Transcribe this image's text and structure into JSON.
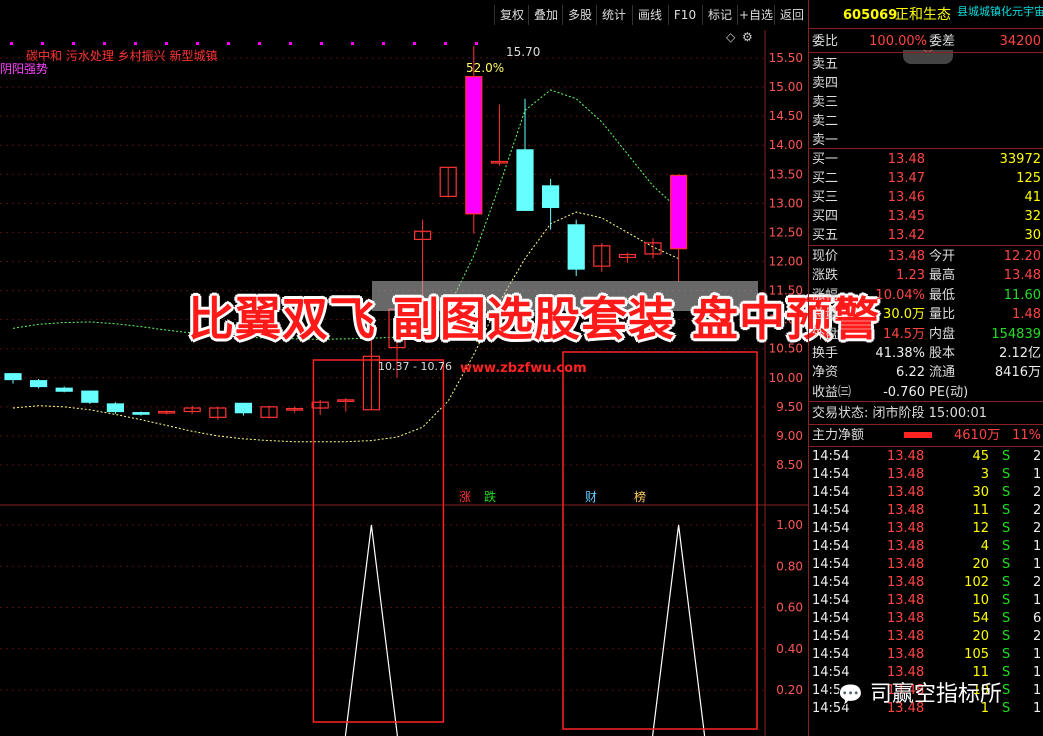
{
  "toolbar": {
    "buttons": [
      "复权",
      "叠加",
      "多股",
      "统计",
      "画线",
      "F10",
      "标记",
      "+自选",
      "返回"
    ]
  },
  "chart": {
    "concepts": "碳中和 污水处理 乡村振兴 新型城镇",
    "indicator_label": "阴阳强势",
    "high_label": "15.70",
    "pct_label": "52.0%",
    "range_label": "10.37 - 10.76",
    "website": "www.zbzfwu.com",
    "tags": [
      "涨",
      "跌",
      "财",
      "榜"
    ],
    "price_ticks": [
      "15.50",
      "15.00",
      "14.50",
      "14.00",
      "13.50",
      "13.00",
      "12.50",
      "12.00",
      "11.50",
      "11.00",
      "10.50",
      "10.00",
      "9.50",
      "9.00",
      "8.50"
    ],
    "sub_ticks": [
      "1.00",
      "0.80",
      "0.60",
      "0.40",
      "0.20"
    ],
    "colors": {
      "up": "#ff00ff",
      "up_border": "#ff3333",
      "down": "#66ffff",
      "ma": "#ffff88",
      "ma2": "#66ff66"
    },
    "candles": [
      {
        "o": 10.07,
        "h": 10.05,
        "l": 9.9,
        "c": 9.97
      },
      {
        "o": 9.95,
        "h": 9.98,
        "l": 9.82,
        "c": 9.85
      },
      {
        "o": 9.82,
        "h": 9.85,
        "l": 9.75,
        "c": 9.77
      },
      {
        "o": 9.77,
        "h": 9.78,
        "l": 9.55,
        "c": 9.58
      },
      {
        "o": 9.55,
        "h": 9.58,
        "l": 9.38,
        "c": 9.42
      },
      {
        "o": 9.4,
        "h": 9.42,
        "l": 9.35,
        "c": 9.38
      },
      {
        "o": 9.4,
        "h": 9.44,
        "l": 9.37,
        "c": 9.42
      },
      {
        "o": 9.42,
        "h": 9.52,
        "l": 9.38,
        "c": 9.48
      },
      {
        "o": 9.32,
        "h": 9.5,
        "l": 9.28,
        "c": 9.48
      },
      {
        "o": 9.56,
        "h": 9.56,
        "l": 9.35,
        "c": 9.4
      },
      {
        "o": 9.32,
        "h": 9.52,
        "l": 9.3,
        "c": 9.5
      },
      {
        "o": 9.45,
        "h": 9.5,
        "l": 9.4,
        "c": 9.47
      },
      {
        "o": 9.48,
        "h": 9.62,
        "l": 9.36,
        "c": 9.58
      },
      {
        "o": 9.6,
        "h": 9.65,
        "l": 9.42,
        "c": 9.62
      },
      {
        "o": 9.45,
        "h": 10.76,
        "l": 9.45,
        "c": 10.37
      },
      {
        "o": 10.52,
        "h": 11.26,
        "l": 10.0,
        "c": 11.18
      },
      {
        "o": 12.38,
        "h": 12.72,
        "l": 11.4,
        "c": 12.52
      },
      {
        "o": 13.12,
        "h": 13.62,
        "l": 13.1,
        "c": 13.62
      },
      {
        "o": 12.82,
        "h": 15.7,
        "l": 12.48,
        "c": 15.18
      },
      {
        "o": 13.72,
        "h": 14.7,
        "l": 13.65,
        "c": 13.72
      },
      {
        "o": 13.92,
        "h": 14.8,
        "l": 12.88,
        "c": 12.88
      },
      {
        "o": 13.3,
        "h": 13.42,
        "l": 12.55,
        "c": 12.93
      },
      {
        "o": 12.63,
        "h": 12.72,
        "l": 11.75,
        "c": 11.87
      },
      {
        "o": 11.92,
        "h": 12.32,
        "l": 11.82,
        "c": 12.27
      },
      {
        "o": 12.07,
        "h": 12.15,
        "l": 11.98,
        "c": 12.12
      },
      {
        "o": 12.13,
        "h": 12.4,
        "l": 12.05,
        "c": 12.32
      },
      {
        "o": 12.22,
        "h": 13.5,
        "l": 11.65,
        "c": 13.48
      }
    ],
    "ma_upper": [
      10.85,
      10.92,
      10.95,
      10.96,
      10.93,
      10.88,
      10.82,
      10.77,
      10.73,
      10.7,
      10.68,
      10.67,
      10.66,
      10.67,
      10.68,
      10.7,
      10.75,
      11.2,
      12.1,
      13.3,
      14.6,
      14.95,
      14.8,
      14.4,
      13.85,
      13.3,
      12.9
    ],
    "ma_lower": [
      9.48,
      9.52,
      9.5,
      9.45,
      9.37,
      9.28,
      9.18,
      9.08,
      9.0,
      8.95,
      8.92,
      8.9,
      8.9,
      8.9,
      8.92,
      8.98,
      9.15,
      9.6,
      10.4,
      11.3,
      12.05,
      12.65,
      12.85,
      12.75,
      12.5,
      12.25,
      12.05
    ],
    "signal": [
      0,
      0,
      0,
      0,
      0,
      0,
      0,
      0,
      0,
      0,
      0,
      0,
      0,
      0,
      1,
      0,
      0,
      0,
      0,
      0,
      0,
      0,
      0,
      0,
      0,
      0,
      1
    ]
  },
  "stock": {
    "code": "605069",
    "name": "正和生态",
    "scroll": "县城城镇化元宇宙",
    "weibi_label": "委比",
    "weibi": "100.00%",
    "weicha_label": "委差",
    "weicha": "34200",
    "asks": [
      {
        "label": "卖五"
      },
      {
        "label": "卖四"
      },
      {
        "label": "卖三"
      },
      {
        "label": "卖二"
      },
      {
        "label": "卖一"
      }
    ],
    "bids": [
      {
        "label": "买一",
        "price": "13.48",
        "vol": "33972"
      },
      {
        "label": "买二",
        "price": "13.47",
        "vol": "125"
      },
      {
        "label": "买三",
        "price": "13.46",
        "vol": "41"
      },
      {
        "label": "买四",
        "price": "13.45",
        "vol": "32"
      },
      {
        "label": "买五",
        "price": "13.42",
        "vol": "30"
      }
    ],
    "quote": [
      {
        "l1": "现价",
        "v1": "13.48",
        "c1": "red",
        "l2": "今开",
        "v2": "12.20",
        "c2": "red"
      },
      {
        "l1": "涨跌",
        "v1": "1.23",
        "c1": "red",
        "l2": "最高",
        "v2": "13.48",
        "c2": "red"
      },
      {
        "l1": "涨幅",
        "v1": "10.04%",
        "c1": "red",
        "l2": "最低",
        "v2": "11.60",
        "c2": "green"
      },
      {
        "l1": "总量",
        "v1": "30.0万",
        "c1": "yellow",
        "l2": "量比",
        "v2": "1.48",
        "c2": "red"
      },
      {
        "l1": "外盘",
        "v1": "14.5万",
        "c1": "red",
        "l2": "内盘",
        "v2": "154839",
        "c2": "green"
      },
      {
        "l1": "换手",
        "v1": "41.38%",
        "c1": "white",
        "l2": "股本",
        "v2": "2.12亿",
        "c2": "white"
      },
      {
        "l1": "净资",
        "v1": "6.22",
        "c1": "white",
        "l2": "流通",
        "v2": "8416万",
        "c2": "white"
      },
      {
        "l1": "收益㈢",
        "v1": "-0.760",
        "c1": "white",
        "l2": "PE(动)",
        "v2": "",
        "c2": "white"
      }
    ],
    "trade_status": "交易状态: 闭市阶段 15:00:01",
    "main_flow_label": "主力净额",
    "main_flow": "4610万",
    "main_flow_pct": "11%",
    "ticks": [
      {
        "t": "14:54",
        "p": "13.48",
        "v": "45",
        "s": "S",
        "n": "2"
      },
      {
        "t": "14:54",
        "p": "13.48",
        "v": "3",
        "s": "S",
        "n": "1"
      },
      {
        "t": "14:54",
        "p": "13.48",
        "v": "30",
        "s": "S",
        "n": "2"
      },
      {
        "t": "14:54",
        "p": "13.48",
        "v": "11",
        "s": "S",
        "n": "2"
      },
      {
        "t": "14:54",
        "p": "13.48",
        "v": "12",
        "s": "S",
        "n": "2"
      },
      {
        "t": "14:54",
        "p": "13.48",
        "v": "4",
        "s": "S",
        "n": "1"
      },
      {
        "t": "14:54",
        "p": "13.48",
        "v": "20",
        "s": "S",
        "n": "1"
      },
      {
        "t": "14:54",
        "p": "13.48",
        "v": "102",
        "s": "S",
        "n": "2"
      },
      {
        "t": "14:54",
        "p": "13.48",
        "v": "10",
        "s": "S",
        "n": "1"
      },
      {
        "t": "14:54",
        "p": "13.48",
        "v": "54",
        "s": "S",
        "n": "6"
      },
      {
        "t": "14:54",
        "p": "13.48",
        "v": "20",
        "s": "S",
        "n": "2"
      },
      {
        "t": "14:54",
        "p": "13.48",
        "v": "105",
        "s": "S",
        "n": "1"
      },
      {
        "t": "14:54",
        "p": "13.48",
        "v": "11",
        "s": "S",
        "n": "1"
      },
      {
        "t": "14:54",
        "p": "13.48",
        "v": "10",
        "s": "S",
        "n": "1"
      },
      {
        "t": "14:54",
        "p": "13.48",
        "v": "1",
        "s": "S",
        "n": "1"
      }
    ]
  },
  "overlay": {
    "banner": "比翼双飞 副图选股套装 盘中预警",
    "watermark": "司赢空指标所"
  }
}
